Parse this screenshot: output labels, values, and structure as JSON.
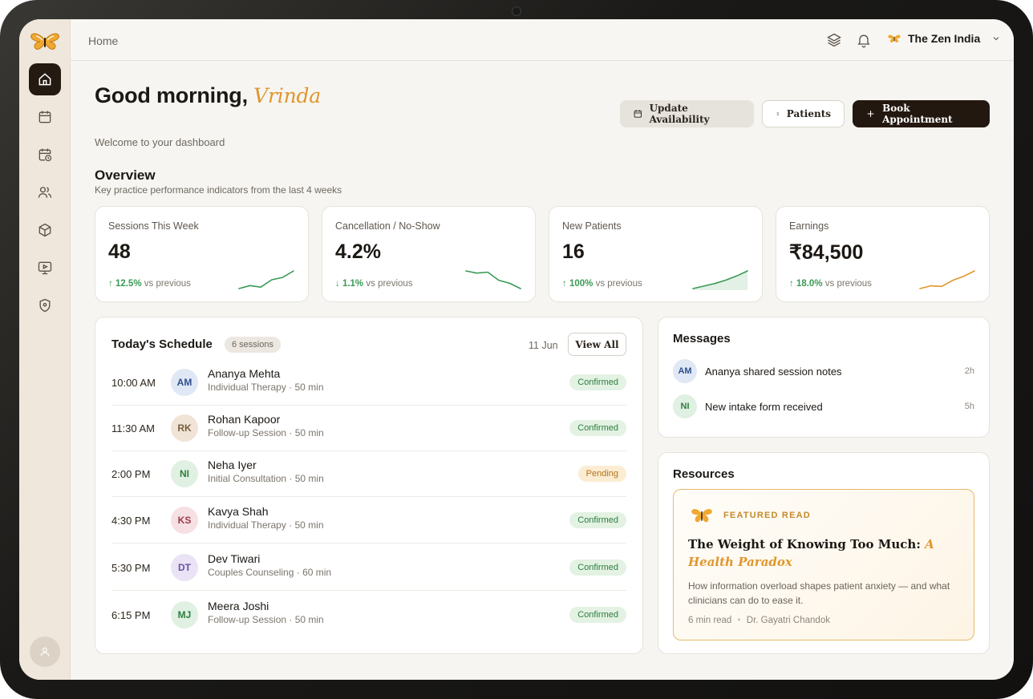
{
  "header": {
    "breadcrumb": "Home",
    "org_name": "The Zen India"
  },
  "sidebar": {
    "items": [
      {
        "name": "home",
        "active": true
      },
      {
        "name": "calendar"
      },
      {
        "name": "schedule"
      },
      {
        "name": "patients"
      },
      {
        "name": "packages"
      },
      {
        "name": "media"
      },
      {
        "name": "security"
      }
    ]
  },
  "greeting": {
    "prefix": "Good morning, ",
    "name": "Vrinda",
    "subtitle": "Welcome to your dashboard"
  },
  "actions": {
    "update_availability": "Update Availability",
    "patients": "Patients",
    "book_appointment": "Book Appointment"
  },
  "overview": {
    "title": "Overview",
    "subtitle": "Key practice performance indicators from the last 4 weeks",
    "vs_label": "vs previous",
    "kpis": [
      {
        "label": "Sessions This Week",
        "value": "48",
        "delta": "↑ 12.5%",
        "trend": [
          3,
          4,
          3.5,
          6,
          6.8,
          9
        ],
        "color": "#3a9a55",
        "fill": false
      },
      {
        "label": "Cancellation / No-Show",
        "value": "4.2%",
        "delta": "↓ 1.1%",
        "trend": [
          7,
          6.3,
          6.6,
          4,
          3,
          1.3
        ],
        "color": "#3a9a55",
        "fill": false
      },
      {
        "label": "New Patients",
        "value": "16",
        "delta": "↑ 100%",
        "trend": [
          1.5,
          3,
          4.5,
          6.5,
          9,
          12
        ],
        "color": "#3a9a55",
        "fill": true
      },
      {
        "label": "Earnings",
        "value": "₹84,500",
        "delta": "↑ 18.0%",
        "trend": [
          2,
          3,
          2.8,
          5,
          6.5,
          8.5
        ],
        "color": "#e0962c",
        "fill": false
      }
    ]
  },
  "schedule": {
    "title": "Today's Schedule",
    "count_label": "6 sessions",
    "date": "11 Jun",
    "view_all": "View All",
    "rows": [
      {
        "time": "10:00 AM",
        "initials": "AM",
        "name": "Ananya Mehta",
        "session": "Individual Therapy · 50 min",
        "status": "Confirmed",
        "status_type": "confirmed",
        "avatar_bg": "#e0e8f5",
        "avatar_fg": "#2e4f8c"
      },
      {
        "time": "11:30 AM",
        "initials": "RK",
        "name": "Rohan Kapoor",
        "session": "Follow-up Session · 50 min",
        "status": "Confirmed",
        "status_type": "confirmed",
        "avatar_bg": "#efe4d6",
        "avatar_fg": "#7a5c3e"
      },
      {
        "time": "2:00 PM",
        "initials": "NI",
        "name": "Neha Iyer",
        "session": "Initial Consultation · 50 min",
        "status": "Pending",
        "status_type": "pending",
        "avatar_bg": "#e0f0e2",
        "avatar_fg": "#2e7d3f"
      },
      {
        "time": "4:30 PM",
        "initials": "KS",
        "name": "Kavya Shah",
        "session": "Individual Therapy · 50 min",
        "status": "Confirmed",
        "status_type": "confirmed",
        "avatar_bg": "#f6e0e3",
        "avatar_fg": "#9a3a4a"
      },
      {
        "time": "5:30 PM",
        "initials": "DT",
        "name": "Dev Tiwari",
        "session": "Couples Counseling · 60 min",
        "status": "Confirmed",
        "status_type": "confirmed",
        "avatar_bg": "#e9e3f5",
        "avatar_fg": "#6a4fa3"
      },
      {
        "time": "6:15 PM",
        "initials": "MJ",
        "name": "Meera Joshi",
        "session": "Follow-up Session · 50 min",
        "status": "Confirmed",
        "status_type": "confirmed",
        "avatar_bg": "#e0f0e2",
        "avatar_fg": "#2e7d3f"
      }
    ]
  },
  "messages": {
    "title": "Messages",
    "items": [
      {
        "initials": "AM",
        "text": "Ananya shared session notes",
        "time": "2h",
        "avatar_bg": "#e0e8f5",
        "avatar_fg": "#2e4f8c"
      },
      {
        "initials": "NI",
        "text": "New intake form received",
        "time": "5h",
        "avatar_bg": "#e0f0e2",
        "avatar_fg": "#2e7d3f"
      }
    ]
  },
  "resources": {
    "title": "Resources",
    "featured_label": "FEATURED READ",
    "headline_main": "The Weight of Knowing Too Much: ",
    "headline_accent": "A Health Paradox",
    "description": "How information overload shapes patient anxiety — and what clinicians can do to ease it.",
    "read_time": "6 min read",
    "separator": "•",
    "author": "Dr. Gayatri Chandok"
  },
  "colors": {
    "accent": "#e0962c",
    "dark": "#231810",
    "positive": "#3a9a55"
  }
}
